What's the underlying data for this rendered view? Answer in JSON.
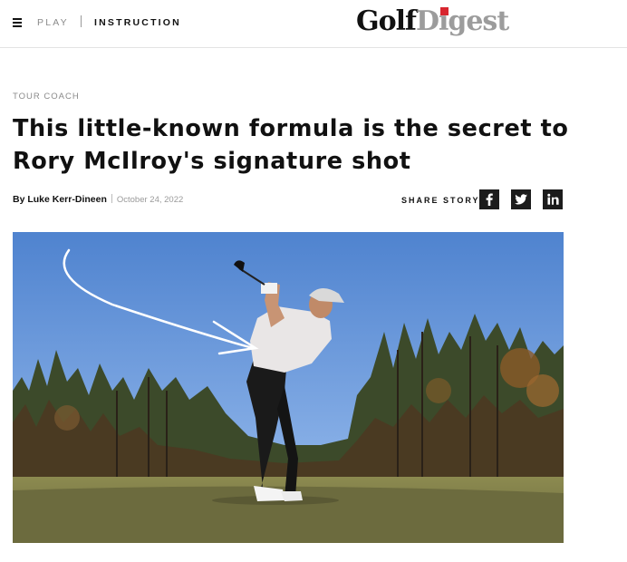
{
  "header": {
    "nav": [
      {
        "label": "PLAY"
      },
      {
        "label": "INSTRUCTION"
      }
    ],
    "logo": {
      "golf": "Golf",
      "digest_d": "D",
      "digest_i": "i",
      "digest_rest": "gest"
    },
    "menu_icon": "hamburger-icon"
  },
  "article": {
    "kicker": "TOUR COACH",
    "title": "This little-known formula is the secret to Rory McIlroy's signature shot",
    "author": "By Luke Kerr-Dineen",
    "date": "October 24, 2022",
    "share_label": "SHARE STORY",
    "share_icons": [
      "facebook-icon",
      "twitter-icon",
      "linkedin-icon"
    ]
  },
  "colors": {
    "logo_red": "#d8262f",
    "share_bg": "#1c1c1c",
    "sky_top": "#4f83cf",
    "sky_bottom": "#a9c6ee"
  }
}
